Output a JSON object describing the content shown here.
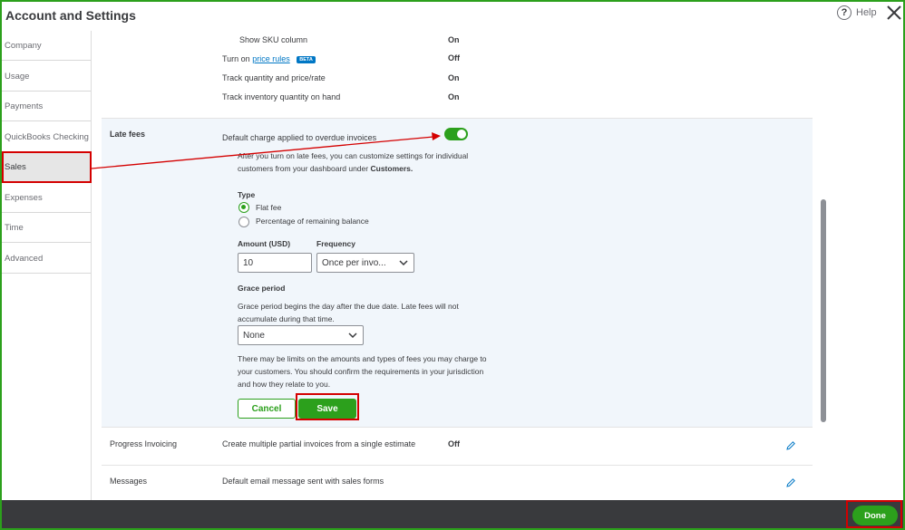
{
  "window": {
    "title": "Account and Settings",
    "help_label": "Help"
  },
  "sidebar": {
    "items": [
      {
        "label": "Company"
      },
      {
        "label": "Usage"
      },
      {
        "label": "Payments"
      },
      {
        "label": "QuickBooks Checking"
      },
      {
        "label": "Sales",
        "active": true
      },
      {
        "label": "Expenses"
      },
      {
        "label": "Time"
      },
      {
        "label": "Advanced"
      }
    ]
  },
  "products_section": {
    "rows": [
      {
        "label": "Show SKU column",
        "value": "On"
      },
      {
        "label_prefix": "Turn on",
        "link": "price rules",
        "badge": "BETA",
        "value": "Off"
      },
      {
        "label": "Track quantity and price/rate",
        "value": "On"
      },
      {
        "label": "Track inventory quantity on hand",
        "value": "On"
      }
    ]
  },
  "late_fees": {
    "section_label": "Late fees",
    "toggle_label": "Default charge applied to overdue invoices",
    "toggle_on": true,
    "info_text_1": "After you turn on late fees, you can customize settings for individual",
    "info_text_2_prefix": "customers from your dashboard under",
    "info_text_2_bold": "Customers.",
    "type_label": "Type",
    "type_options": [
      {
        "label": "Flat fee",
        "selected": true
      },
      {
        "label": "Percentage of remaining balance",
        "selected": false
      }
    ],
    "amount_label": "Amount (USD)",
    "amount_value": "10",
    "frequency_label": "Frequency",
    "frequency_value": "Once per invo...",
    "grace_label": "Grace period",
    "grace_text_1": "Grace period begins the day after the due date. Late fees will not",
    "grace_text_2": "accumulate during that time.",
    "grace_value": "None",
    "disclaimer_1": "There may be limits on the amounts and types of fees you may charge to",
    "disclaimer_2": "your customers. You should confirm the requirements in your jurisdiction",
    "disclaimer_3": "and how they relate to you.",
    "cancel_label": "Cancel",
    "save_label": "Save"
  },
  "progress_invoicing": {
    "label": "Progress Invoicing",
    "description": "Create multiple partial invoices from a single estimate",
    "value": "Off"
  },
  "messages": {
    "label": "Messages",
    "description": "Default email message sent with sales forms"
  },
  "footer": {
    "done_label": "Done"
  },
  "colors": {
    "brand_green": "#2ca01c",
    "annotation_red": "#d40000",
    "link_blue": "#0077c5",
    "footer_dark": "#393a3d"
  },
  "icons": [
    "help-icon",
    "close-icon",
    "chevron-down-icon",
    "pencil-icon"
  ]
}
